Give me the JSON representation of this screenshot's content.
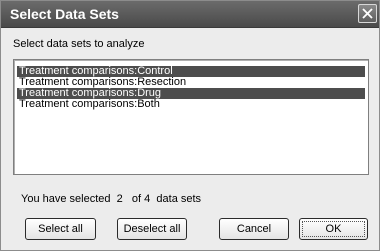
{
  "window": {
    "title": "Select Data Sets",
    "close_icon": "close-icon"
  },
  "instruction": "Select data sets to analyze",
  "datasets": [
    {
      "label": "Treatment comparisons:Control",
      "selected": true
    },
    {
      "label": "Treatment comparisons:Resection",
      "selected": false
    },
    {
      "label": "Treatment comparisons:Drug",
      "selected": true
    },
    {
      "label": "Treatment comparisons:Both",
      "selected": false
    }
  ],
  "status": {
    "prefix": "You have selected",
    "selected_count": "2",
    "of_text": "of",
    "total_count": "4",
    "suffix": "data sets"
  },
  "buttons": {
    "select_all": "Select all",
    "deselect_all": "Deselect all",
    "cancel": "Cancel",
    "ok": "OK"
  },
  "colors": {
    "selection": "#4d4d4d",
    "titlebar": "#5a5a5a"
  }
}
